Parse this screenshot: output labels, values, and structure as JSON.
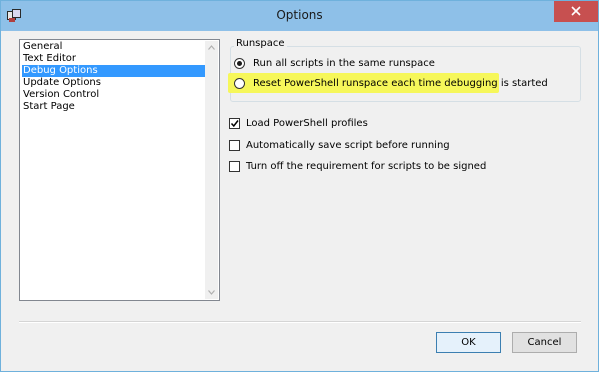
{
  "window": {
    "title": "Options"
  },
  "categories": [
    "General",
    "Text Editor",
    "Debug Options",
    "Update Options",
    "Version Control",
    "Start Page"
  ],
  "selected_category": "Debug Options",
  "runspace": {
    "label": "Runspace",
    "option1": "Run all scripts in the same runspace",
    "option2": "Reset PowerShell runspace each time debugging is started",
    "selected": "option1",
    "highlighted": "option2",
    "highlight_color": "#f6f75a"
  },
  "checks": [
    {
      "label": "Load PowerShell profiles",
      "checked": true
    },
    {
      "label": "Automatically save script before running",
      "checked": false
    },
    {
      "label": "Turn off the requirement for scripts to be signed",
      "checked": false
    }
  ],
  "buttons": {
    "ok": "OK",
    "cancel": "Cancel"
  },
  "colors": {
    "titlebar": "#8ec0e8",
    "close": "#c75050",
    "selection": "#3399ff"
  }
}
